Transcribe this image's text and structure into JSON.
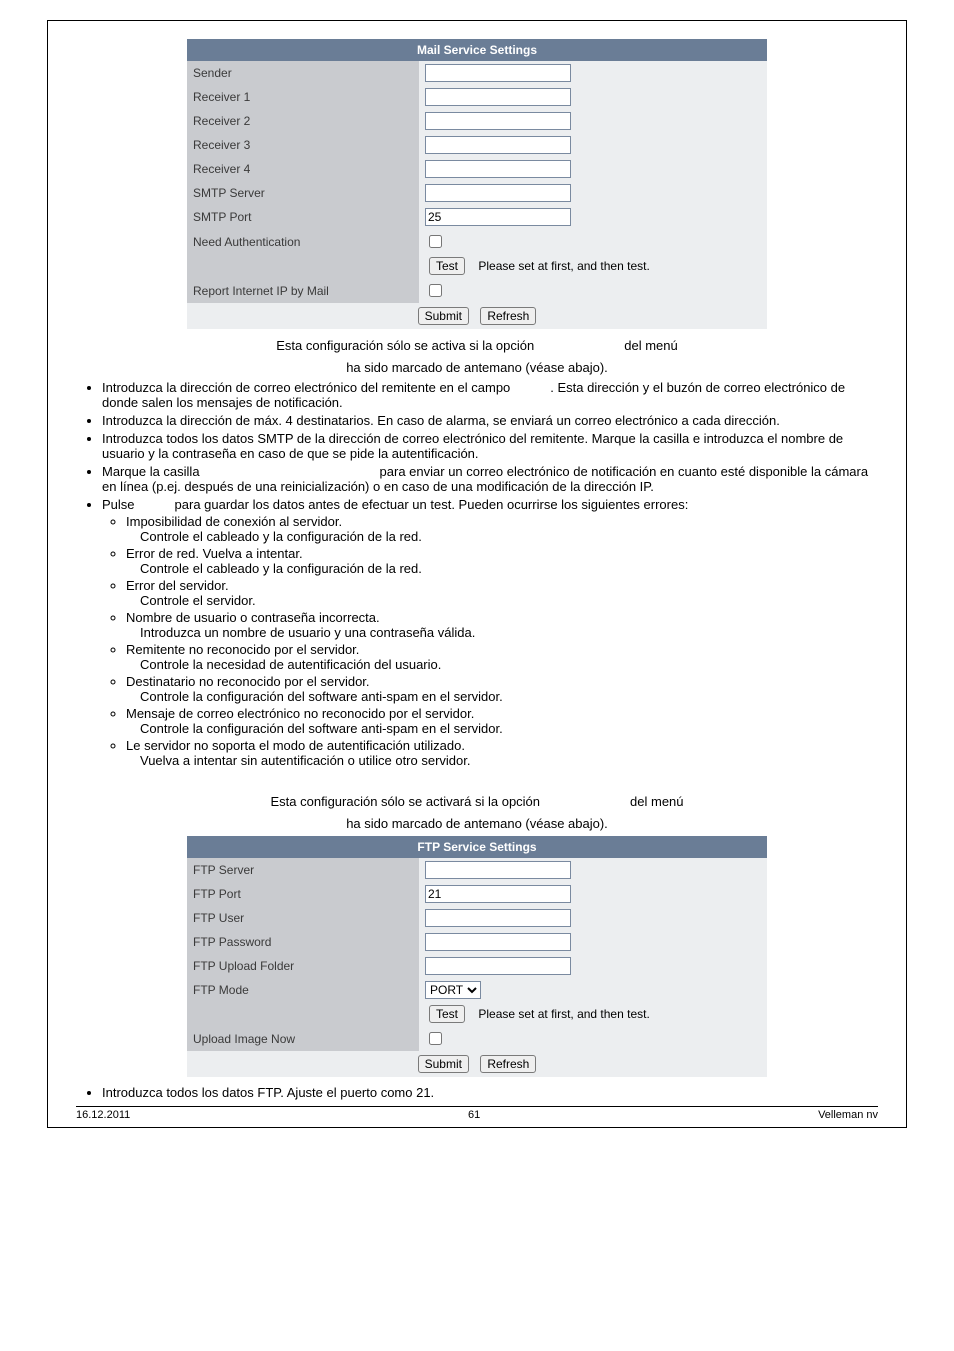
{
  "mail": {
    "header": "Mail Service Settings",
    "rows": {
      "sender": "Sender",
      "receiver1": "Receiver 1",
      "receiver2": "Receiver 2",
      "receiver3": "Receiver 3",
      "receiver4": "Receiver 4",
      "smtp_server": "SMTP Server",
      "smtp_port": "SMTP Port",
      "need_auth": "Need Authentication",
      "report_ip": "Report Internet IP by Mail"
    },
    "values": {
      "smtp_port": "25"
    },
    "test_btn": "Test",
    "test_note": "Please set at first, and then test.",
    "submit": "Submit",
    "refresh": "Refresh"
  },
  "text": {
    "intro1a": "Esta configuración sólo se activa si la opción",
    "intro1b": "del menú",
    "intro2": "ha sido marcado de antemano (véase abajo).",
    "b1a": "Introduzca la dirección de correo electrónico del remitente en el campo",
    "b1b": ". Esta dirección y el buzón de correo electrónico de donde salen los mensajes de notificación.",
    "b2": "Introduzca la dirección de máx. 4 destinatarios. En caso de alarma, se enviará un correo electrónico a cada dirección.",
    "b3": "Introduzca todos los datos SMTP de la dirección de correo electrónico del remitente. Marque la casilla e introduzca el nombre de usuario y la contraseña en caso de que se pide la autentificación.",
    "b4a": "Marque la casilla",
    "b4b": "para enviar un correo electrónico de notificación en cuanto esté disponible la cámara en línea (p.ej. después de una reinicialización) o en caso de una modificación de la dirección IP.",
    "b5a": "Pulse",
    "b5b": "para guardar los datos antes de efectuar un test. Pueden ocurrirse los siguientes errores:",
    "e1": "Imposibilidad de conexión al servidor.",
    "e1s": "Controle el cableado y la configuración de la red.",
    "e2": "Error de red. Vuelva a intentar.",
    "e2s": "Controle el cableado y la configuración de la red.",
    "e3": "Error del servidor.",
    "e3s": "Controle el servidor.",
    "e4": "Nombre de usuario o contraseña incorrecta.",
    "e4s": "Introduzca un nombre de usuario y una contraseña válida.",
    "e5": "Remitente no reconocido por el servidor.",
    "e5s": "Controle la necesidad de autentificación del usuario.",
    "e6": "Destinatario no reconocido por el servidor.",
    "e6s": "Controle la configuración del software anti-spam en el servidor.",
    "e7": "Mensaje de correo electrónico no reconocido por el servidor.",
    "e7s": "Controle la configuración del software anti-spam en el servidor.",
    "e8": "Le servidor no soporta el modo de autentificación utilizado.",
    "e8s": "Vuelva a intentar sin autentificación o utilice otro servidor.",
    "ftp_intro1a": "Esta configuración sólo se activará si la opción",
    "ftp_intro1b": "del menú",
    "ftp_intro2": "ha sido marcado de antemano (véase abajo).",
    "ftp_last": "Introduzca todos los datos FTP. Ajuste el puerto como 21."
  },
  "ftp": {
    "header": "FTP Service Settings",
    "rows": {
      "server": "FTP Server",
      "port": "FTP Port",
      "user": "FTP User",
      "password": "FTP Password",
      "folder": "FTP Upload Folder",
      "mode": "FTP Mode",
      "upload_now": "Upload Image Now"
    },
    "values": {
      "port": "21",
      "mode": "PORT"
    },
    "test_btn": "Test",
    "test_note": "Please set at first, and then test.",
    "submit": "Submit",
    "refresh": "Refresh"
  },
  "footer": {
    "date": "16.12.2011",
    "page": "61",
    "brand": "Velleman nv"
  }
}
